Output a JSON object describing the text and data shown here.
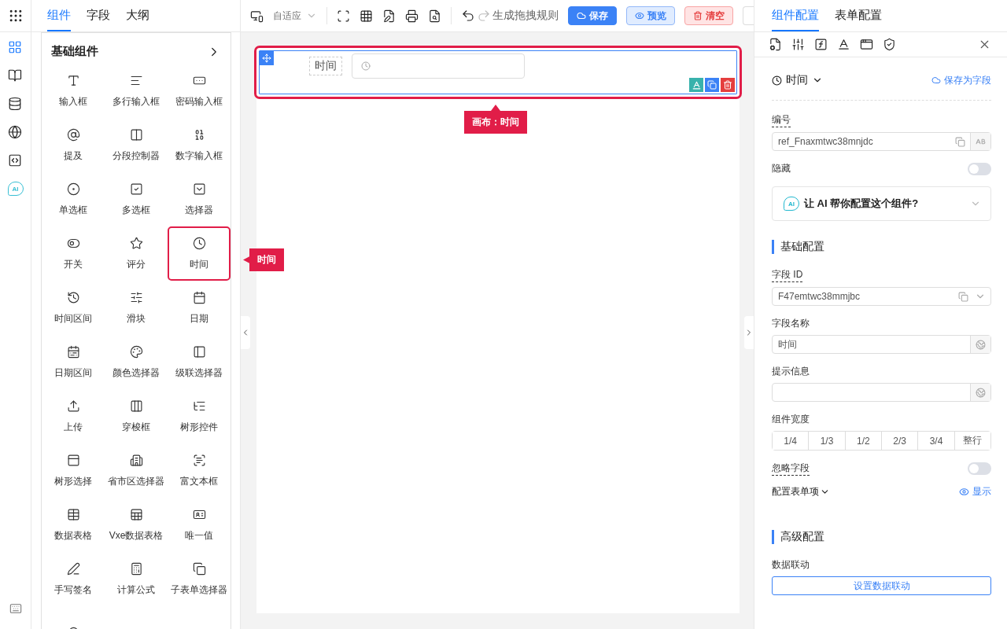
{
  "rail": [
    {
      "kind": "components",
      "selected": true
    },
    {
      "kind": "book",
      "selected": false
    },
    {
      "kind": "database",
      "selected": false
    },
    {
      "kind": "globe",
      "selected": false
    },
    {
      "kind": "code",
      "selected": false
    },
    {
      "kind": "ai",
      "label": "AI",
      "selected": false
    }
  ],
  "left_tabs": [
    {
      "label": "组件",
      "selected": true
    },
    {
      "label": "字段",
      "selected": false
    },
    {
      "label": "大纲",
      "selected": false
    }
  ],
  "palette": {
    "title": "基础组件",
    "callout": "时间",
    "items": [
      {
        "label": "输入框",
        "selected": false
      },
      {
        "label": "多行输入框",
        "selected": false
      },
      {
        "label": "密码输入框",
        "selected": false
      },
      {
        "label": "提及",
        "selected": false
      },
      {
        "label": "分段控制器",
        "selected": false
      },
      {
        "label": "数字输入框",
        "selected": false
      },
      {
        "label": "单选框",
        "selected": false
      },
      {
        "label": "多选框",
        "selected": false
      },
      {
        "label": "选择器",
        "selected": false
      },
      {
        "label": "开关",
        "selected": false
      },
      {
        "label": "评分",
        "selected": false
      },
      {
        "label": "时间",
        "selected": true
      },
      {
        "label": "时间区间",
        "selected": false
      },
      {
        "label": "滑块",
        "selected": false
      },
      {
        "label": "日期",
        "selected": false
      },
      {
        "label": "日期区间",
        "selected": false
      },
      {
        "label": "颜色选择器",
        "selected": false
      },
      {
        "label": "级联选择器",
        "selected": false
      },
      {
        "label": "上传",
        "selected": false
      },
      {
        "label": "穿梭框",
        "selected": false
      },
      {
        "label": "树形控件",
        "selected": false
      },
      {
        "label": "树形选择",
        "selected": false
      },
      {
        "label": "省市区选择器",
        "selected": false
      },
      {
        "label": "富文本框",
        "selected": false
      },
      {
        "label": "数据表格",
        "selected": false
      },
      {
        "label": "Vxe数据表格",
        "selected": false
      },
      {
        "label": "唯一值",
        "selected": false
      },
      {
        "label": "手写签名",
        "selected": false
      },
      {
        "label": "计算公式",
        "selected": false
      },
      {
        "label": "子表单选择器",
        "selected": false
      }
    ]
  },
  "toolbar": {
    "device": "自适应",
    "rule_button": "生成拖拽规则",
    "buttons": [
      {
        "kind": "primary",
        "label": "保存"
      },
      {
        "kind": "info",
        "label": "预览"
      },
      {
        "kind": "danger",
        "label": "清空"
      }
    ]
  },
  "canvas": {
    "field": {
      "label": "时间",
      "selected": true
    },
    "callout": "画布：时间"
  },
  "config": {
    "tabs": [
      {
        "label": "组件配置",
        "selected": true
      },
      {
        "label": "表单配置",
        "selected": false
      }
    ],
    "component_type": "时间",
    "save_as_field": "保存为字段",
    "ref": {
      "label": "编号",
      "value": "ref_Fnaxmtwc38mnjdc"
    },
    "hidden": {
      "label": "隐藏",
      "on": false
    },
    "ai_prompt": {
      "badge": "AI",
      "text": "让 AI 帮你配置这个组件?"
    },
    "basic": {
      "title": "基础配置",
      "field_id": {
        "label": "字段 ID",
        "value": "F47emtwc38mmjbc"
      },
      "field_name": {
        "label": "字段名称",
        "value": "时间"
      },
      "hint": {
        "label": "提示信息"
      },
      "width": {
        "label": "组件宽度",
        "options": [
          {
            "label": "1/4",
            "selected": false
          },
          {
            "label": "1/3",
            "selected": false
          },
          {
            "label": "1/2",
            "selected": false
          },
          {
            "label": "2/3",
            "selected": false
          },
          {
            "label": "3/4",
            "selected": false
          },
          {
            "label": "整行",
            "selected": false
          }
        ]
      },
      "ignore": {
        "label": "忽略字段",
        "on": false
      },
      "form_items": {
        "label": "配置表单项",
        "action": "显示"
      }
    },
    "advanced": {
      "title": "高级配置",
      "linkage_label": "数据联动",
      "linkage_button": "设置数据联动"
    }
  }
}
